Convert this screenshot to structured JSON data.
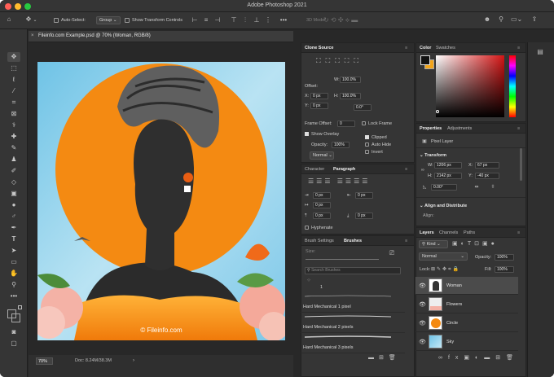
{
  "app": {
    "title": "Adobe Photoshop 2021"
  },
  "options_bar": {
    "auto_select_label": "Auto-Select:",
    "auto_select_value": "Group",
    "show_transform_controls_label": "Show Transform Controls",
    "mode_3d_label": "3D Mode:"
  },
  "document": {
    "tab_title": "Fileinfo.com Example.psd @ 70% (Woman, RGB/8)",
    "watermark": "© Fileinfo.com",
    "zoom": "70%",
    "doc_size": "Doc: 8.24M/38.3M"
  },
  "clone_source": {
    "tab": "Clone Source",
    "offset_label": "Offset:",
    "w_label": "W:",
    "w_value": "100.0%",
    "h_label": "H:",
    "h_value": "100.0%",
    "x_label": "X:",
    "x_value": "0 px",
    "y_label": "Y:",
    "y_value": "0 px",
    "angle_value": "0.0",
    "angle_unit": "°",
    "frame_offset_label": "Frame Offset:",
    "frame_offset_value": "0",
    "lock_frame_label": "Lock Frame",
    "show_overlay_label": "Show Overlay",
    "opacity_label": "Opacity:",
    "opacity_value": "100%",
    "clipped_label": "Clipped",
    "auto_hide_label": "Auto Hide",
    "invert_label": "Invert",
    "blend_value": "Normal"
  },
  "character": {
    "tabs": [
      "Character",
      "Paragraph"
    ],
    "indent_left": "0 px",
    "indent_first": "0 px",
    "indent_right": "0 px",
    "space_before": "0 px",
    "space_after": "0 px",
    "hyphenate_label": "Hyphenate"
  },
  "brushes": {
    "tabs": [
      "Brush Settings",
      "Brushes"
    ],
    "size_label": "Size:",
    "search_placeholder": "Search Brushes",
    "preset_size": "1",
    "items": [
      "Hard Mechanical 1 pixel",
      "Hard Mechanical 2 pixels",
      "Hard Mechanical 3 pixels"
    ]
  },
  "color": {
    "tabs": [
      "Color",
      "Swatches"
    ],
    "foreground": "#111111",
    "background": "#f2a51a"
  },
  "properties": {
    "tabs": [
      "Properties",
      "Adjustments"
    ],
    "layer_type": "Pixel Layer",
    "transform_label": "Transform",
    "w_label": "W:",
    "w_value": "1206 px",
    "x_label": "X:",
    "x_value": "67 px",
    "h_label": "H:",
    "h_value": "2142 px",
    "y_label": "Y:",
    "y_value": "-40 px",
    "angle_value": "0.00°",
    "align_label": "Align and Distribute",
    "align_sub": "Align:"
  },
  "layers": {
    "tabs": [
      "Layers",
      "Channels",
      "Paths"
    ],
    "kind_label": "Kind",
    "blend_mode": "Normal",
    "opacity_label": "Opacity:",
    "opacity_value": "100%",
    "lock_label": "Lock:",
    "fill_label": "Fill:",
    "fill_value": "100%",
    "items": [
      {
        "name": "Woman",
        "selected": true
      },
      {
        "name": "Flowers",
        "selected": false
      },
      {
        "name": "Circle",
        "selected": false
      },
      {
        "name": "Sky",
        "selected": false
      }
    ]
  },
  "colors": {
    "accent_orange": "#f48a12",
    "sky_blue": "#8ecfe8",
    "selection_gray": "#4b4b4b"
  }
}
